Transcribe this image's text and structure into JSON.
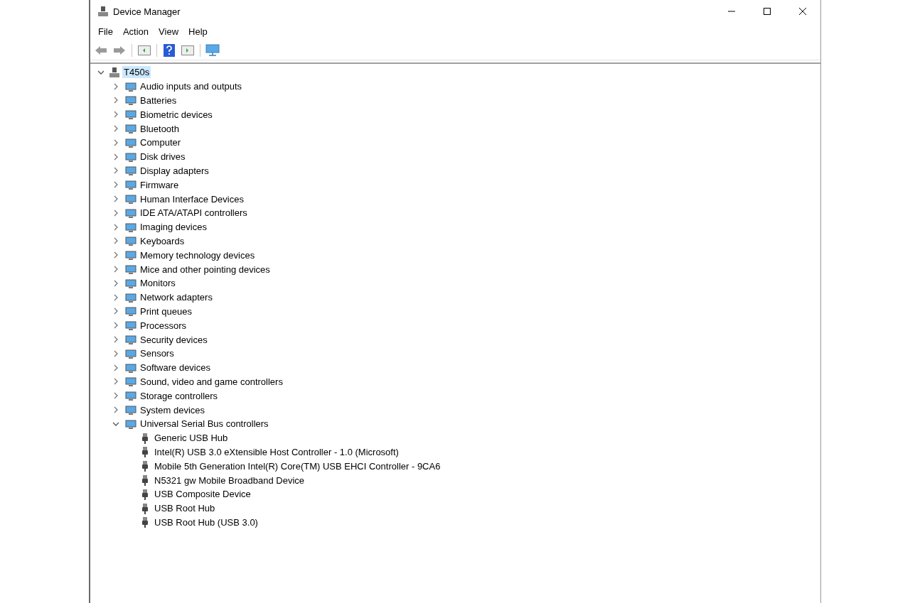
{
  "window": {
    "title": "Device Manager"
  },
  "menu": [
    {
      "label": "File"
    },
    {
      "label": "Action"
    },
    {
      "label": "View"
    },
    {
      "label": "Help"
    }
  ],
  "tree": {
    "label": "T450s",
    "expanded": true,
    "selected": true,
    "children": [
      {
        "label": "Audio inputs and outputs",
        "expanded": false
      },
      {
        "label": "Batteries",
        "expanded": false
      },
      {
        "label": "Biometric devices",
        "expanded": false
      },
      {
        "label": "Bluetooth",
        "expanded": false
      },
      {
        "label": "Computer",
        "expanded": false
      },
      {
        "label": "Disk drives",
        "expanded": false
      },
      {
        "label": "Display adapters",
        "expanded": false
      },
      {
        "label": "Firmware",
        "expanded": false
      },
      {
        "label": "Human Interface Devices",
        "expanded": false
      },
      {
        "label": "IDE ATA/ATAPI controllers",
        "expanded": false
      },
      {
        "label": "Imaging devices",
        "expanded": false
      },
      {
        "label": "Keyboards",
        "expanded": false
      },
      {
        "label": "Memory technology devices",
        "expanded": false
      },
      {
        "label": "Mice and other pointing devices",
        "expanded": false
      },
      {
        "label": "Monitors",
        "expanded": false
      },
      {
        "label": "Network adapters",
        "expanded": false
      },
      {
        "label": "Print queues",
        "expanded": false
      },
      {
        "label": "Processors",
        "expanded": false
      },
      {
        "label": "Security devices",
        "expanded": false
      },
      {
        "label": "Sensors",
        "expanded": false
      },
      {
        "label": "Software devices",
        "expanded": false
      },
      {
        "label": "Sound, video and game controllers",
        "expanded": false
      },
      {
        "label": "Storage controllers",
        "expanded": false
      },
      {
        "label": "System devices",
        "expanded": false
      },
      {
        "label": "Universal Serial Bus controllers",
        "expanded": true,
        "children": [
          {
            "label": "Generic USB Hub"
          },
          {
            "label": "Intel(R) USB 3.0 eXtensible Host Controller - 1.0 (Microsoft)"
          },
          {
            "label": "Mobile 5th Generation Intel(R) Core(TM) USB EHCI Controller - 9CA6"
          },
          {
            "label": "N5321 gw Mobile Broadband Device"
          },
          {
            "label": "USB Composite Device"
          },
          {
            "label": "USB Root Hub"
          },
          {
            "label": "USB Root Hub (USB 3.0)"
          }
        ]
      }
    ]
  }
}
